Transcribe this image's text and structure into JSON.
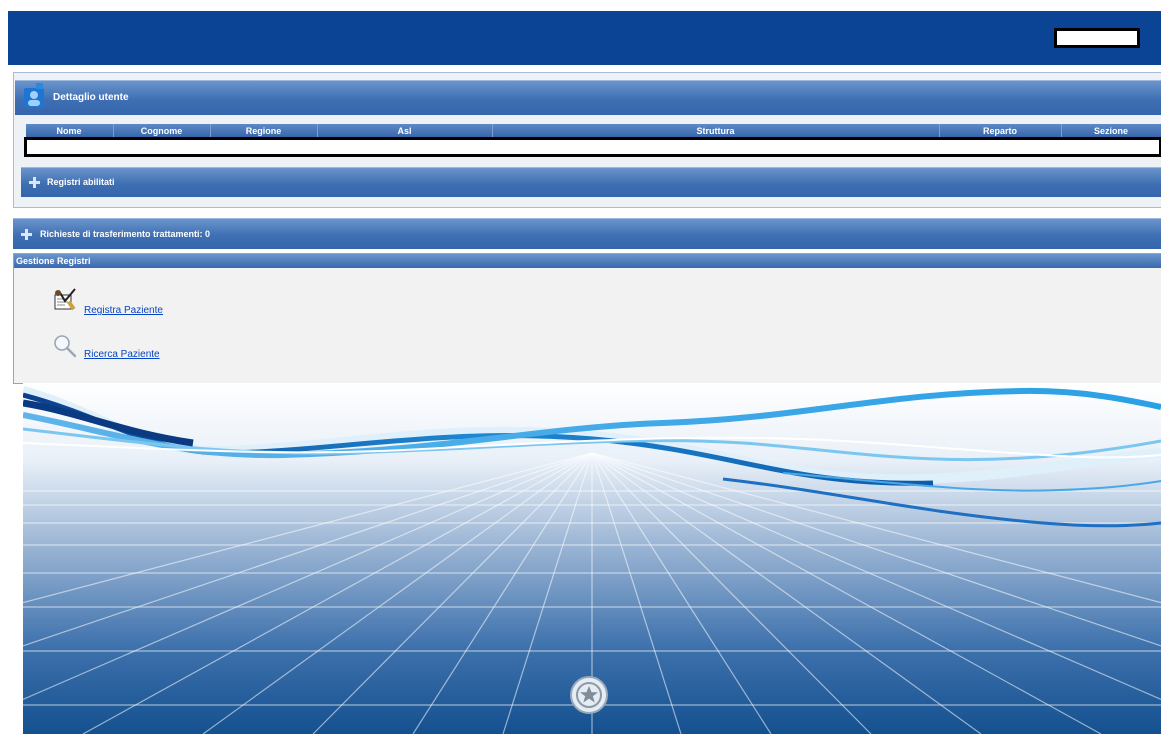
{
  "header": {
    "user_name": ""
  },
  "user_detail": {
    "title": "Dettaglio utente",
    "columns": [
      "Nome",
      "Cognome",
      "Regione",
      "Asl",
      "Struttura",
      "Reparto",
      "Sezione"
    ],
    "row": [
      "",
      "",
      "",
      "",
      "",
      "",
      ""
    ]
  },
  "registri": {
    "title": "Registri abilitati"
  },
  "richieste": {
    "title": "Richieste di trasferimento trattamenti: 0"
  },
  "gestione": {
    "title": "Gestione Registri",
    "actions": [
      {
        "label": "Registra Paziente",
        "icon": "register-patient-icon"
      },
      {
        "label": "Ricerca Paziente",
        "icon": "search-icon"
      }
    ]
  },
  "colors": {
    "topbar": "#0b4395",
    "section_header": "#3f6fb3",
    "link": "#0645c6"
  }
}
